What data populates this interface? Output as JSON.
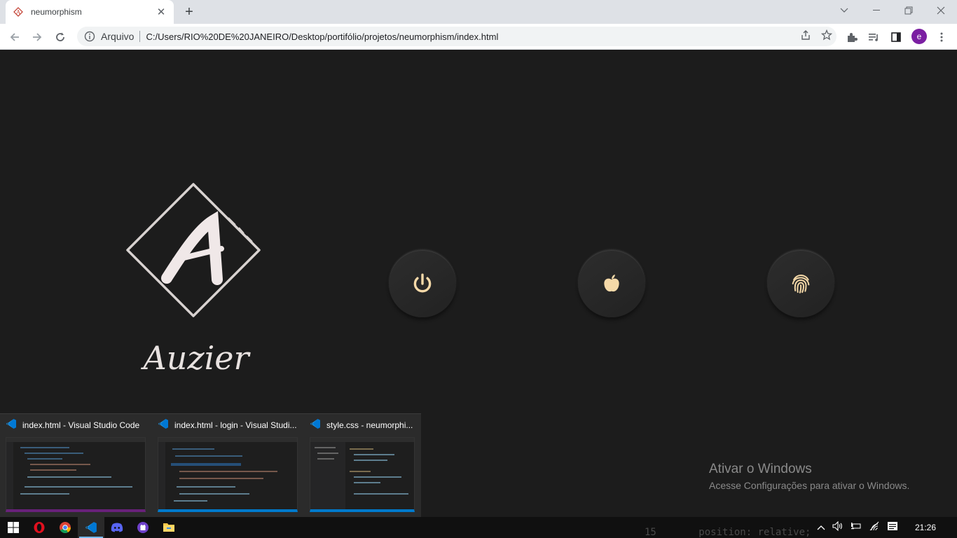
{
  "browser": {
    "tab": {
      "title": "neumorphism"
    },
    "omnibox": {
      "security_label": "Arquivo",
      "url": "C:/Users/RIO%20DE%20JANEIRO/Desktop/portifólio/projetos/neumorphism/index.html"
    },
    "profile_initial": "e"
  },
  "page": {
    "logo_text": "Auzier",
    "buttons": [
      {
        "name": "power-button",
        "icon": "power-icon"
      },
      {
        "name": "apple-button",
        "icon": "apple-icon"
      },
      {
        "name": "fingerprint-button",
        "icon": "fingerprint-icon"
      }
    ],
    "accent_color": "#f5d9a8"
  },
  "taskbar_thumbnails": [
    {
      "title": "index.html - Visual Studio Code"
    },
    {
      "title": "index.html - login - Visual Studi..."
    },
    {
      "title": "style.css - neumorphi..."
    }
  ],
  "watermark": {
    "title": "Ativar o Windows",
    "subtitle": "Acesse Configurações para ativar o Windows."
  },
  "background_code": {
    "line_number": "15",
    "line_text": "position: relative;"
  },
  "taskbar": {
    "apps": [
      "start-icon",
      "opera-icon",
      "chrome-icon",
      "vscode-icon",
      "discord-icon",
      "github-icon",
      "file-explorer-icon"
    ],
    "clock": "21:26"
  }
}
